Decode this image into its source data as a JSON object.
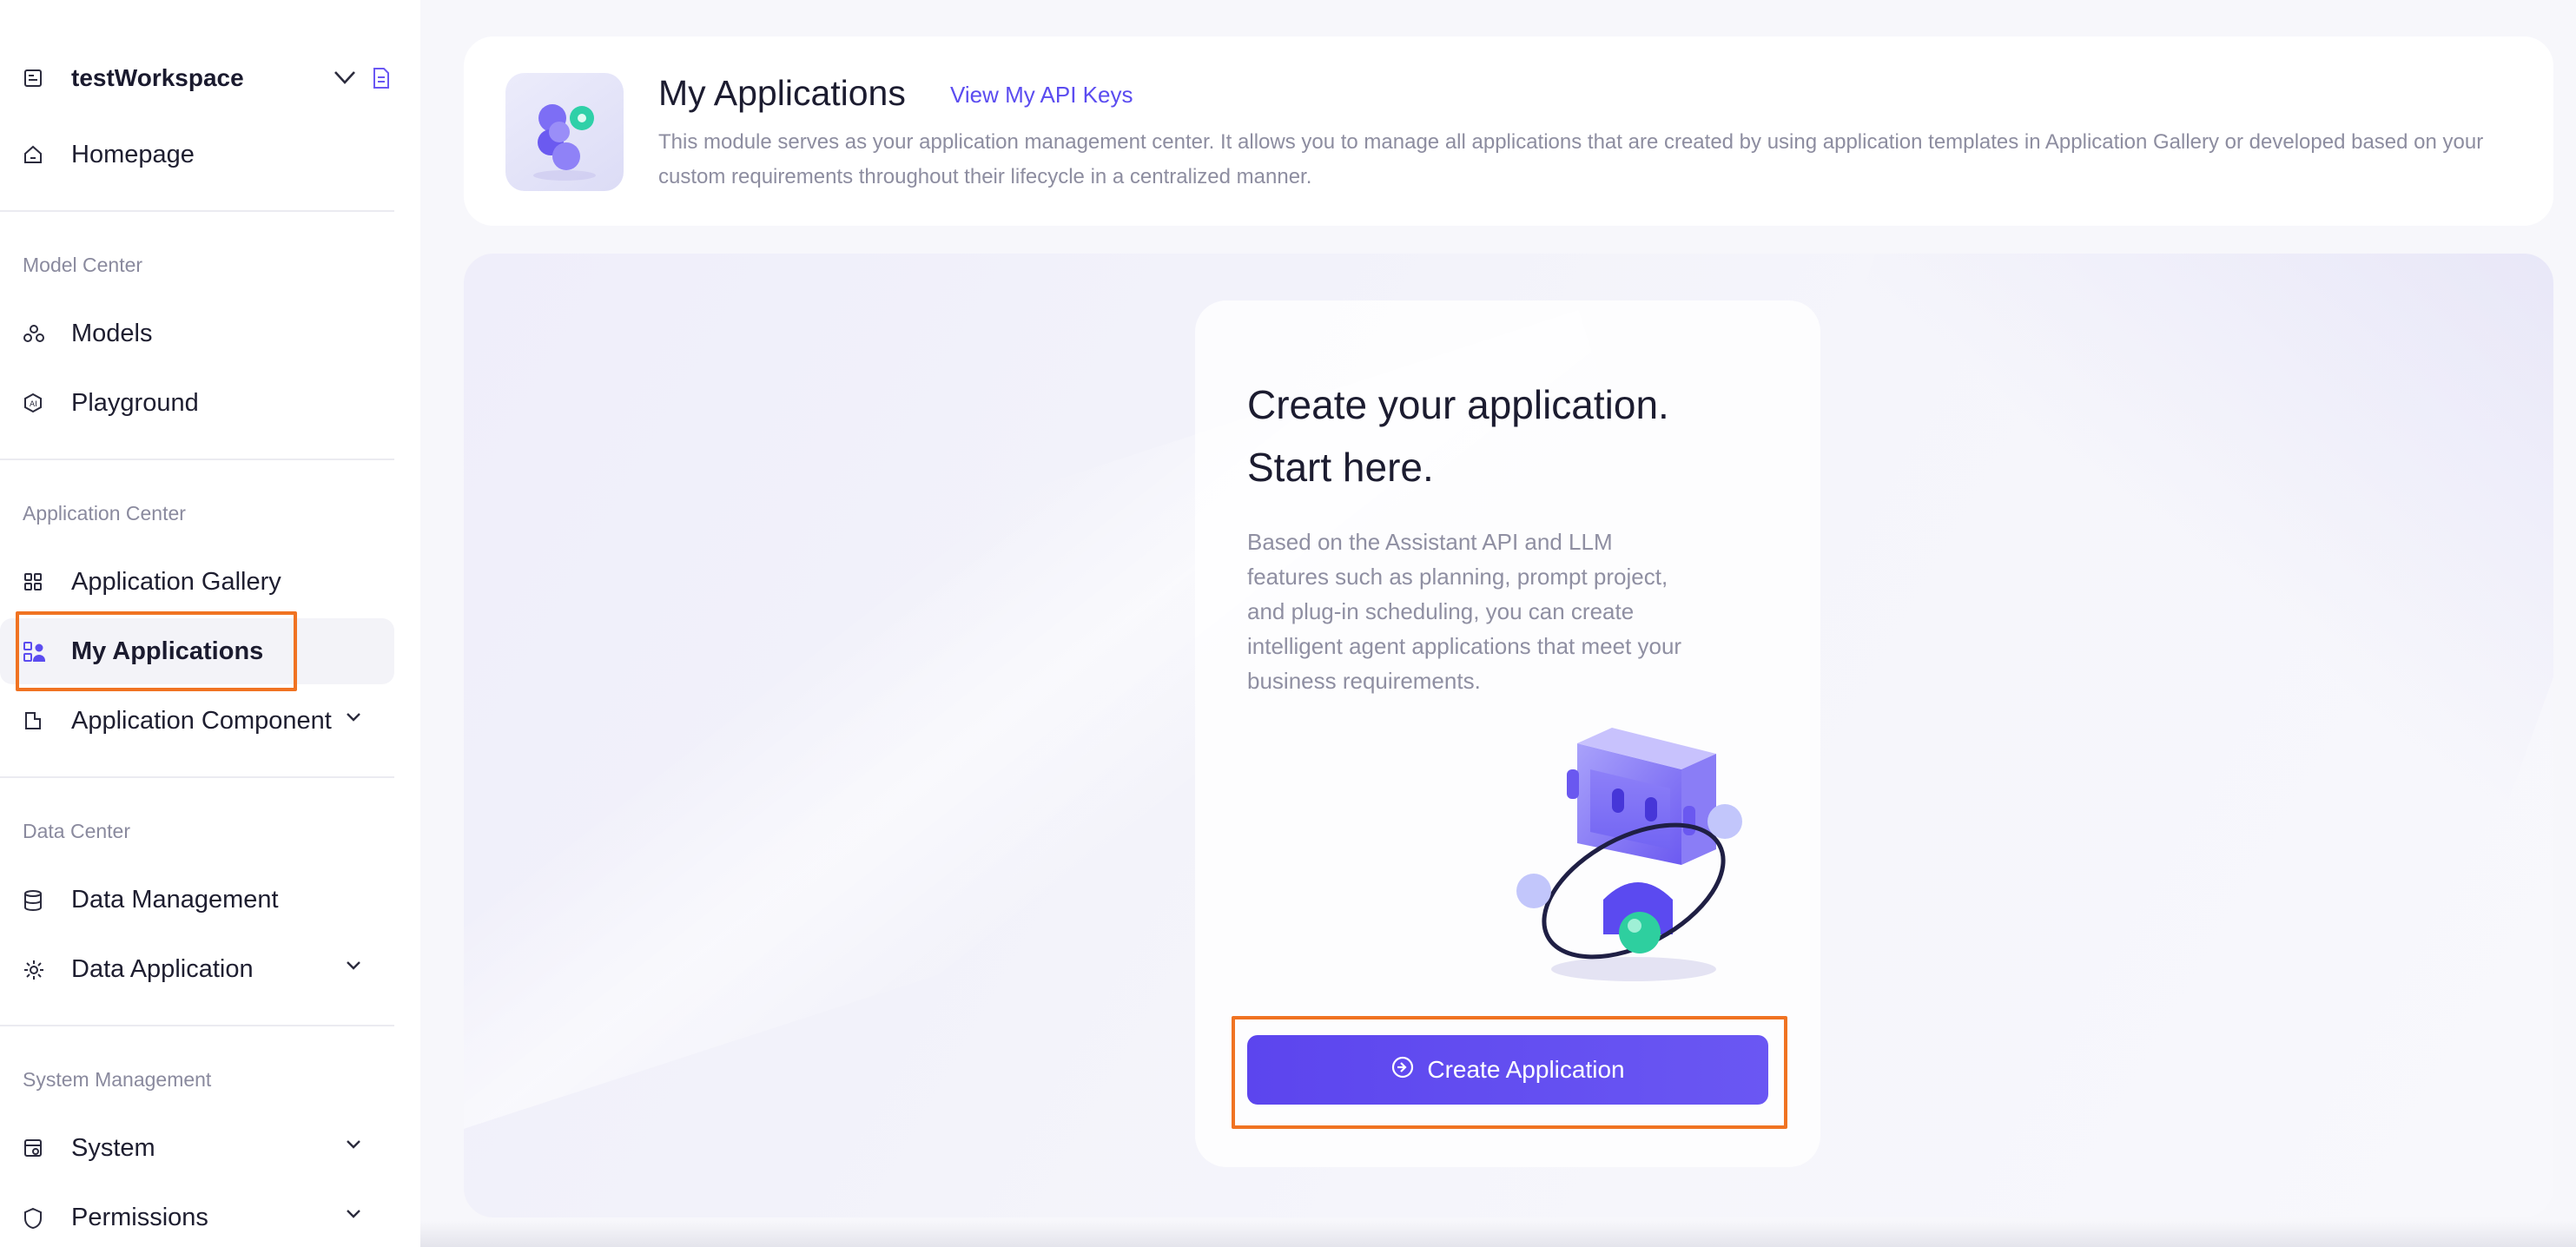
{
  "workspace": {
    "name": "testWorkspace"
  },
  "sidebar": {
    "homepage": "Homepage",
    "sections": {
      "model_center": "Model Center",
      "application_center": "Application Center",
      "data_center": "Data Center",
      "system_management": "System Management"
    },
    "items": {
      "models": "Models",
      "playground": "Playground",
      "application_gallery": "Application Gallery",
      "my_applications": "My Applications",
      "application_component": "Application Component",
      "data_management": "Data Management",
      "data_application": "Data Application",
      "system": "System",
      "permissions": "Permissions"
    },
    "active": "my_applications"
  },
  "header": {
    "title": "My Applications",
    "link": "View My API Keys",
    "description": "This module serves as your application management center. It allows you to manage all applications that are created by using application templates in Application Gallery or developed based on your custom requirements throughout their lifecycle in a centralized manner."
  },
  "hero": {
    "title_line1": "Create your application.",
    "title_line2": "Start here.",
    "description": "Based on the Assistant API and LLM features such as planning, prompt project, and plug-in scheduling, you can create intelligent agent applications that meet your business requirements.",
    "button": "Create Application"
  },
  "colors": {
    "accent": "#5b4cf0",
    "highlight": "#f07322"
  },
  "icons": {
    "workspace": "workspace-icon",
    "homepage": "home-icon",
    "models": "models-icon",
    "playground": "playground-icon",
    "gallery": "grid-icon",
    "my_apps": "my-apps-icon",
    "component": "component-icon",
    "data_management": "database-icon",
    "data_application": "gear-icon",
    "system": "system-icon",
    "permissions": "shield-icon"
  }
}
